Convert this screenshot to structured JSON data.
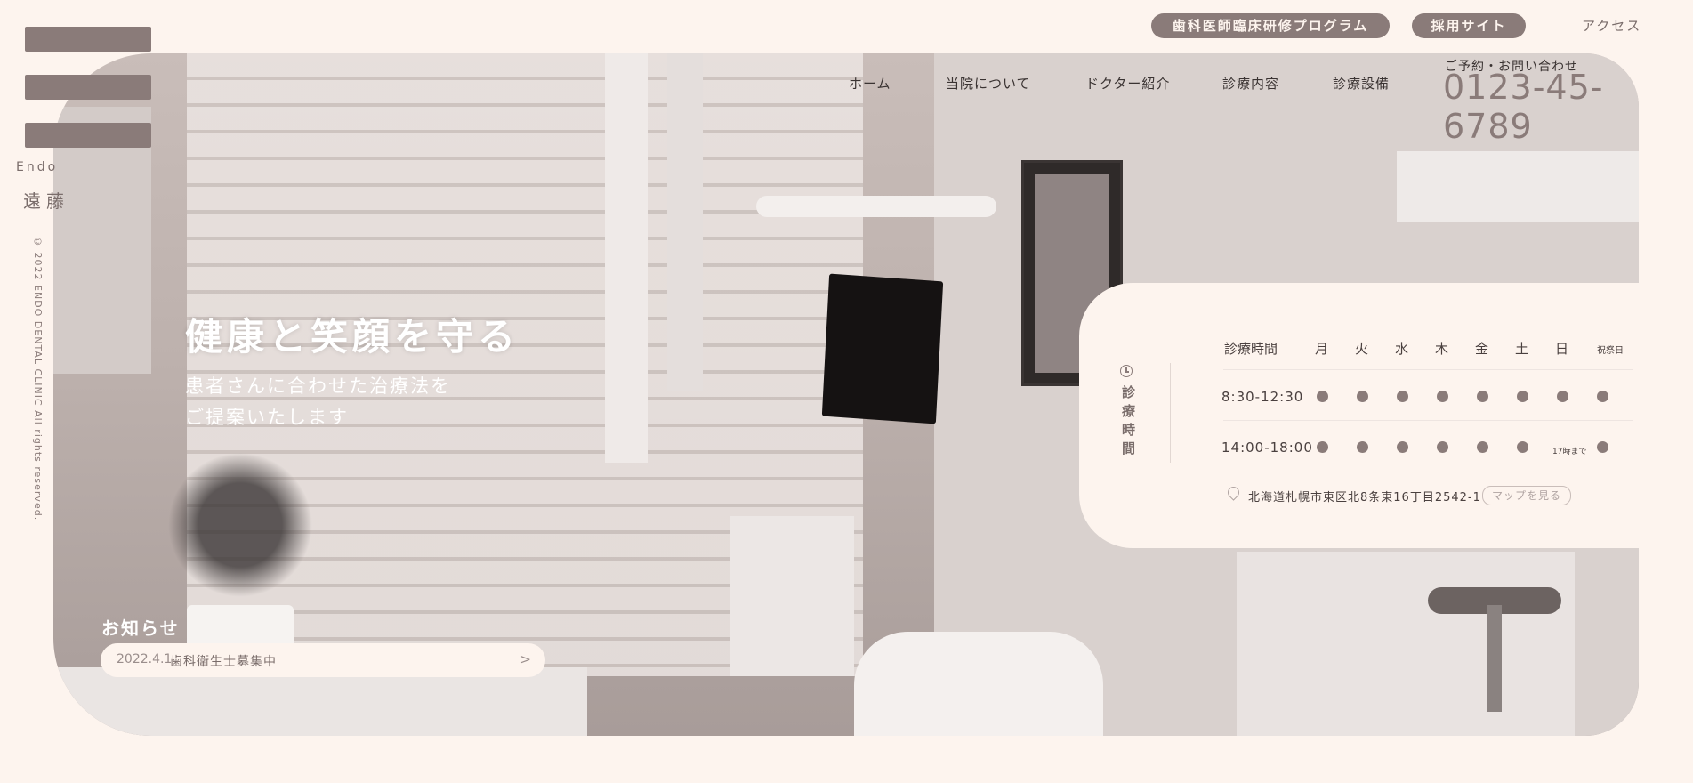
{
  "top_links": {
    "training": "歯科医師臨床研修プログラム",
    "recruit": "採用サイト",
    "access": "アクセス"
  },
  "logo": {
    "en": "Endo",
    "jp": "遠藤"
  },
  "copyright": "© 2022 ENDO DENTAL CLINIC All rights reserved.",
  "nav": {
    "home": "ホーム",
    "about": "当院について",
    "doctor": "ドクター紹介",
    "treatment": "診療内容",
    "equipment": "診療設備"
  },
  "contact": {
    "label": "ご予約・お問い合わせ",
    "phone": "0123-45-6789"
  },
  "hero": {
    "title": "健康と笑顔を守る",
    "sub1": "患者さんに合わせた治療法を",
    "sub2": "ご提案いたします"
  },
  "news": {
    "heading": "お知らせ",
    "date": "2022.4.1",
    "title": "歯科衛生士募集中",
    "arrow": ">"
  },
  "hours": {
    "vertical_label": "診療時間",
    "header_label": "診療時間",
    "days": [
      "月",
      "火",
      "水",
      "木",
      "金",
      "土",
      "日",
      "祝祭日"
    ],
    "rows": [
      {
        "time": "8:30-12:30",
        "open": [
          true,
          true,
          true,
          true,
          true,
          true,
          true,
          true
        ],
        "notes": [
          "",
          "",
          "",
          "",
          "",
          "",
          "",
          ""
        ]
      },
      {
        "time": "14:00-18:00",
        "open": [
          true,
          true,
          true,
          true,
          true,
          true,
          false,
          true
        ],
        "notes": [
          "",
          "",
          "",
          "",
          "",
          "",
          "17時まで",
          ""
        ]
      }
    ],
    "address": "北海道札幌市東区北8条東16丁目2542-1",
    "map_button": "マップを見る"
  },
  "colors": {
    "background": "#fdf4ee",
    "accent": "#8a7b79",
    "text": "#4a403f"
  },
  "icons": {
    "clock": "clock-icon",
    "pin": "map-pin-icon",
    "arrow": "chevron-right-icon"
  }
}
